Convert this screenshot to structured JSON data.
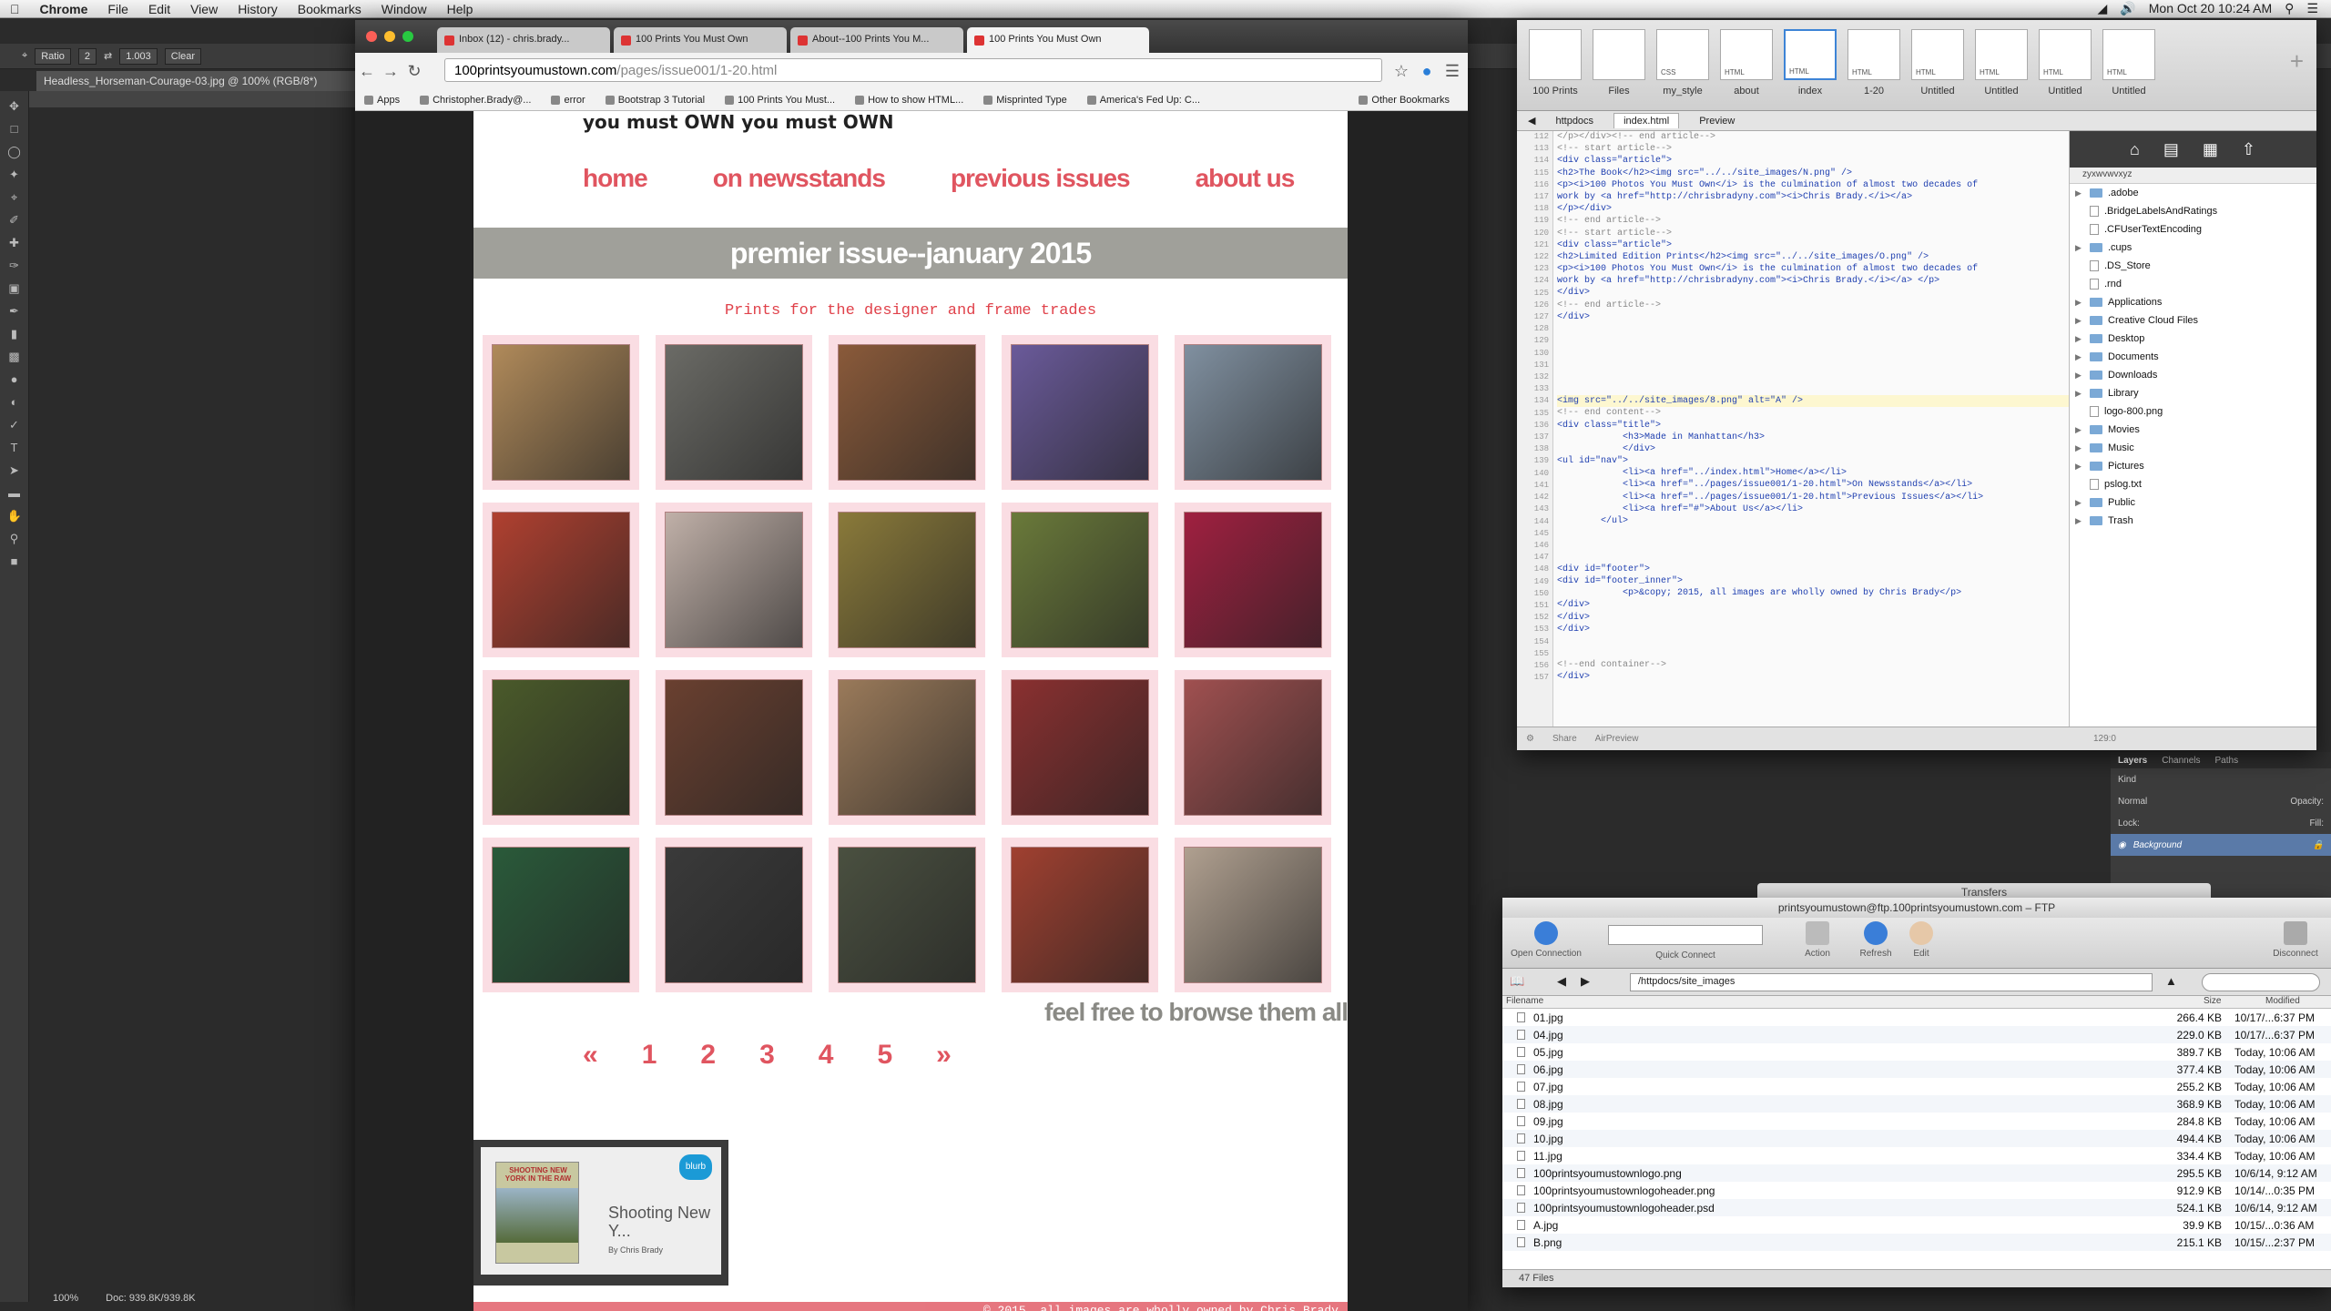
{
  "menubar": {
    "app": "Chrome",
    "items": [
      "File",
      "Edit",
      "View",
      "History",
      "Bookmarks",
      "Window",
      "Help"
    ],
    "clock": "Mon Oct 20  10:24 AM"
  },
  "photoshop": {
    "ratio": "Ratio",
    "w": "2",
    "h": "1.003",
    "clear": "Clear",
    "doc_tab": "Headless_Horseman-Courage-03.jpg @ 100% (RGB/8*)",
    "zoom": "100%",
    "doc_size": "Doc: 939.8K/939.8K",
    "layers": {
      "tabs": [
        "Layers",
        "Channels",
        "Paths"
      ],
      "kind": "Kind",
      "mode": "Normal",
      "opacity": "Opacity:",
      "lock": "Lock:",
      "fill": "Fill:",
      "layer_name": "Background"
    }
  },
  "chrome": {
    "tabs": [
      "Inbox (12) - chris.brady...",
      "100 Prints You Must Own",
      "About--100 Prints You M...",
      "100 Prints You Must Own"
    ],
    "url_host": "100printsyoumustown.com",
    "url_path": "/pages/issue001/1-20.html",
    "bookmarks": [
      "Apps",
      "Christopher.Brady@...",
      "error",
      "Bootstrap 3 Tutorial",
      "100 Prints You Must...",
      "How to show HTML...",
      "Misprinted Type",
      "America's Fed Up: C..."
    ],
    "other_bookmarks": "Other Bookmarks"
  },
  "site": {
    "logo_line": "you must  OWN    you must  OWN",
    "nav": [
      "home",
      "on newsstands",
      "previous issues",
      "about us"
    ],
    "issue_title": "premier issue--january 2015",
    "tagline": "Prints for the designer and frame trades",
    "thumb_colors": [
      [
        "#b08a5a",
        "#6b6b66",
        "#8a5a3a",
        "#6a5a9a",
        "#8090a0"
      ],
      [
        "#b04030",
        "#c0b0a8",
        "#8a7a3a",
        "#6a7a3a",
        "#a02040"
      ],
      [
        "#4a5a2a",
        "#6a4030",
        "#9a7a5a",
        "#8a3030",
        "#a05050"
      ],
      [
        "#2a5a3a",
        "#3a3a3a",
        "#4a5040",
        "#a04030",
        "#b0a090"
      ]
    ],
    "browse": "feel free to browse them all",
    "pager": [
      "«",
      "1",
      "2",
      "3",
      "4",
      "5",
      "»"
    ],
    "blurb": {
      "book_text": "SHOOTING NEW YORK IN THE RAW",
      "badge": "blurb",
      "title": "Shooting New Y...",
      "by": "By Chris Brady"
    },
    "footer": "© 2015, all images are wholly owned by Chris Brady"
  },
  "editor": {
    "tiles": [
      "100 Prints",
      "Files",
      "my_style",
      "about",
      "index",
      "1-20",
      "Untitled",
      "Untitled",
      "Untitled",
      "Untitled"
    ],
    "tile_types": [
      "",
      "",
      "CSS",
      "HTML",
      "HTML",
      "HTML",
      "HTML",
      "HTML",
      "HTML",
      "HTML"
    ],
    "tabs": [
      "httpdocs",
      "index.html",
      "Preview"
    ],
    "line_numbers": "112\n113\n114\n115\n116\n117\n118\n119\n120\n121\n122\n123\n124\n125\n126\n127\n128\n129\n130\n131\n132\n133\n134\n135\n136\n137\n138\n139\n140\n141\n142\n143\n144\n145\n146\n147\n148\n149\n150\n151\n152\n153\n154\n155\n156\n157",
    "code": [
      {
        "t": "</p></div><!-- end article-->",
        "c": "cm"
      },
      {
        "t": "<!-- start article-->",
        "c": "cm"
      },
      {
        "t": "<div class=\"article\">",
        "c": ""
      },
      {
        "t": "<h2>The Book</h2><img src=\"../../site_images/N.png\" />",
        "c": ""
      },
      {
        "t": "<p><i>100 Photos You Must Own</i> is the culmination of almost two decades of",
        "c": ""
      },
      {
        "t": "work by <a href=\"http://chrisbradyny.com\"><i>Chris Brady.</i></a>",
        "c": ""
      },
      {
        "t": "</p></div>",
        "c": ""
      },
      {
        "t": "<!-- end article-->",
        "c": "cm"
      },
      {
        "t": "<!-- start article-->",
        "c": "cm"
      },
      {
        "t": "<div class=\"article\">",
        "c": ""
      },
      {
        "t": "<h2>Limited Edition Prints</h2><img src=\"../../site_images/O.png\" />",
        "c": ""
      },
      {
        "t": "<p><i>100 Photos You Must Own</i> is the culmination of almost two decades of",
        "c": ""
      },
      {
        "t": "work by <a href=\"http://chrisbradyny.com\"><i>Chris Brady.</i></a> </p>",
        "c": ""
      },
      {
        "t": "</div>",
        "c": ""
      },
      {
        "t": "<!-- end article-->",
        "c": "cm"
      },
      {
        "t": "</div>",
        "c": ""
      },
      {
        "t": "",
        "c": ""
      },
      {
        "t": "",
        "c": ""
      },
      {
        "t": "",
        "c": ""
      },
      {
        "t": "",
        "c": ""
      },
      {
        "t": "",
        "c": ""
      },
      {
        "t": "",
        "c": ""
      },
      {
        "t": "<img src=\"../../site_images/8.png\" alt=\"A\" />",
        "c": "hl"
      },
      {
        "t": "<!-- end content-->",
        "c": "cm"
      },
      {
        "t": "<div class=\"title\">",
        "c": ""
      },
      {
        "t": "            <h3>Made in Manhattan</h3>",
        "c": ""
      },
      {
        "t": "            </div>",
        "c": ""
      },
      {
        "t": "<ul id=\"nav\">",
        "c": ""
      },
      {
        "t": "            <li><a href=\"../index.html\">Home</a></li>",
        "c": ""
      },
      {
        "t": "            <li><a href=\"../pages/issue001/1-20.html\">On Newsstands</a></li>",
        "c": ""
      },
      {
        "t": "            <li><a href=\"../pages/issue001/1-20.html\">Previous Issues</a></li>",
        "c": ""
      },
      {
        "t": "            <li><a href=\"#\">About Us</a></li>",
        "c": ""
      },
      {
        "t": "        </ul>",
        "c": ""
      },
      {
        "t": "",
        "c": ""
      },
      {
        "t": "",
        "c": ""
      },
      {
        "t": "",
        "c": ""
      },
      {
        "t": "<div id=\"footer\">",
        "c": ""
      },
      {
        "t": "<div id=\"footer_inner\">",
        "c": ""
      },
      {
        "t": "            <p>&copy; 2015, all images are wholly owned by Chris Brady</p>",
        "c": ""
      },
      {
        "t": "</div>",
        "c": ""
      },
      {
        "t": "</div>",
        "c": ""
      },
      {
        "t": "</div>",
        "c": ""
      },
      {
        "t": "",
        "c": ""
      },
      {
        "t": "",
        "c": ""
      },
      {
        "t": "<!--end container-->",
        "c": "cm"
      },
      {
        "t": "</div>",
        "c": ""
      }
    ],
    "sidebar_user": "zyxwvwvxyz",
    "files": [
      {
        "n": ".adobe",
        "d": true
      },
      {
        "n": ".BridgeLabelsAndRatings",
        "d": false
      },
      {
        "n": ".CFUserTextEncoding",
        "d": false
      },
      {
        "n": ".cups",
        "d": true
      },
      {
        "n": ".DS_Store",
        "d": false
      },
      {
        "n": ".rnd",
        "d": false
      },
      {
        "n": "Applications",
        "d": true
      },
      {
        "n": "Creative Cloud Files",
        "d": true
      },
      {
        "n": "Desktop",
        "d": true
      },
      {
        "n": "Documents",
        "d": true
      },
      {
        "n": "Downloads",
        "d": true
      },
      {
        "n": "Library",
        "d": true
      },
      {
        "n": "logo-800.png",
        "d": false
      },
      {
        "n": "Movies",
        "d": true
      },
      {
        "n": "Music",
        "d": true
      },
      {
        "n": "Pictures",
        "d": true
      },
      {
        "n": "pslog.txt",
        "d": false
      },
      {
        "n": "Public",
        "d": true
      },
      {
        "n": "Trash",
        "d": true
      }
    ],
    "status_share": "Share",
    "status_airpreview": "AirPreview",
    "status_pos": "129:0"
  },
  "ftp": {
    "back_title": "Transfers",
    "title": "printsyoumustown@ftp.100printsyoumustown.com – FTP",
    "open_connection": "Open Connection",
    "quick_connect": "Quick Connect",
    "action": "Action",
    "refresh": "Refresh",
    "edit": "Edit",
    "disconnect": "Disconnect",
    "path": "/httpdocs/site_images",
    "headers": [
      "Filename",
      "Size",
      "Modified"
    ],
    "rows": [
      [
        "01.jpg",
        "266.4 KB",
        "10/17/...6:37 PM"
      ],
      [
        "04.jpg",
        "229.0 KB",
        "10/17/...6:37 PM"
      ],
      [
        "05.jpg",
        "389.7 KB",
        "Today, 10:06 AM"
      ],
      [
        "06.jpg",
        "377.4 KB",
        "Today, 10:06 AM"
      ],
      [
        "07.jpg",
        "255.2 KB",
        "Today, 10:06 AM"
      ],
      [
        "08.jpg",
        "368.9 KB",
        "Today, 10:06 AM"
      ],
      [
        "09.jpg",
        "284.8 KB",
        "Today, 10:06 AM"
      ],
      [
        "10.jpg",
        "494.4 KB",
        "Today, 10:06 AM"
      ],
      [
        "11.jpg",
        "334.4 KB",
        "Today, 10:06 AM"
      ],
      [
        "100printsyoumustownlogo.png",
        "295.5 KB",
        "10/6/14, 9:12 AM"
      ],
      [
        "100printsyoumustownlogoheader.png",
        "912.9 KB",
        "10/14/...0:35 PM"
      ],
      [
        "100printsyoumustownlogoheader.psd",
        "524.1 KB",
        "10/6/14, 9:12 AM"
      ],
      [
        "A.jpg",
        "39.9 KB",
        "10/15/...0:36 AM"
      ],
      [
        "B.png",
        "215.1 KB",
        "10/15/...2:37 PM"
      ]
    ],
    "count": "47 Files"
  }
}
